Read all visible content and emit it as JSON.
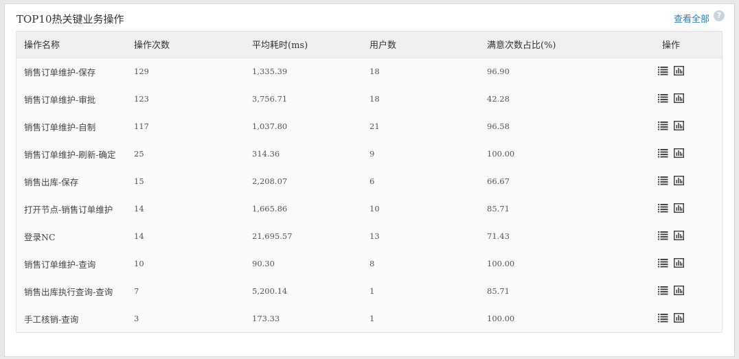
{
  "panel": {
    "title": "TOP10热关键业务操作",
    "view_all": "查看全部",
    "help_icon": "?"
  },
  "table": {
    "columns": [
      "操作名称",
      "操作次数",
      "平均耗时(ms)",
      "用户数",
      "满意次数占比(%)",
      "操作"
    ],
    "rows": [
      {
        "name": "销售订单维护-保存",
        "count": "129",
        "avg": "1,335.39",
        "users": "18",
        "ratio": "96.90"
      },
      {
        "name": "销售订单维护-审批",
        "count": "123",
        "avg": "3,756.71",
        "users": "18",
        "ratio": "42.28"
      },
      {
        "name": "销售订单维护-自制",
        "count": "117",
        "avg": "1,037.80",
        "users": "21",
        "ratio": "96.58"
      },
      {
        "name": "销售订单维护-刷新-确定",
        "count": "25",
        "avg": "314.36",
        "users": "9",
        "ratio": "100.00"
      },
      {
        "name": "销售出库-保存",
        "count": "15",
        "avg": "2,208.07",
        "users": "6",
        "ratio": "66.67"
      },
      {
        "name": "打开节点-销售订单维护",
        "count": "14",
        "avg": "1,665.86",
        "users": "10",
        "ratio": "85.71"
      },
      {
        "name": "登录NC",
        "count": "14",
        "avg": "21,695.57",
        "users": "13",
        "ratio": "71.43"
      },
      {
        "name": "销售订单维护-查询",
        "count": "10",
        "avg": "90.30",
        "users": "8",
        "ratio": "100.00"
      },
      {
        "name": "销售出库执行查询-查询",
        "count": "7",
        "avg": "5,200.14",
        "users": "1",
        "ratio": "85.71"
      },
      {
        "name": "手工核销-查询",
        "count": "3",
        "avg": "173.33",
        "users": "1",
        "ratio": "100.00"
      }
    ],
    "row_actions": [
      "list-icon",
      "bar-chart-icon"
    ]
  },
  "colors": {
    "link": "#2c7bc6",
    "header_bg": "#efefef",
    "page_bg": "#e9e9e9"
  }
}
